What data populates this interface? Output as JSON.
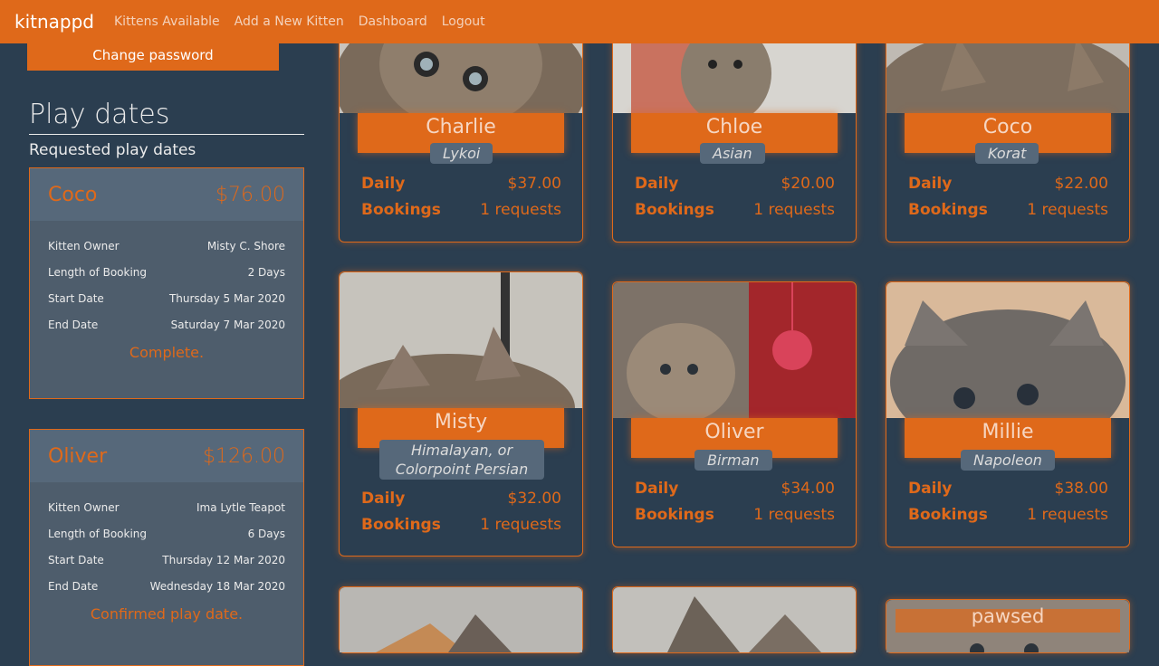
{
  "nav": {
    "brand": "kitnappd",
    "links": [
      "Kittens Available",
      "Add a New Kitten",
      "Dashboard",
      "Logout"
    ]
  },
  "sidebar": {
    "change_password": "Change password",
    "title": "Play dates",
    "subtitle": "Requested play dates",
    "labels": {
      "owner": "Kitten Owner",
      "length": "Length of Booking",
      "start": "Start Date",
      "end": "End Date"
    },
    "playdates": [
      {
        "name": "Coco",
        "price": "$76.00",
        "owner": "Misty C. Shore",
        "length": "2 Days",
        "start": "Thursday 5 Mar 2020",
        "end": "Saturday 7 Mar 2020",
        "status": "Complete."
      },
      {
        "name": "Oliver",
        "price": "$126.00",
        "owner": "Ima Lytle Teapot",
        "length": "6 Days",
        "start": "Thursday 12 Mar 2020",
        "end": "Wednesday 18 Mar 2020",
        "status": "Confirmed play date."
      }
    ]
  },
  "kitten_labels": {
    "daily": "Daily",
    "bookings": "Bookings"
  },
  "kittens": [
    {
      "name": "Charlie",
      "breed": "Lykoi",
      "daily": "$37.00",
      "bookings": "1 requests"
    },
    {
      "name": "Chloe",
      "breed": "Asian",
      "daily": "$20.00",
      "bookings": "1 requests"
    },
    {
      "name": "Coco",
      "breed": "Korat",
      "daily": "$22.00",
      "bookings": "1 requests"
    },
    {
      "name": "Misty",
      "breed": "Himalayan, or Colorpoint Persian",
      "daily": "$32.00",
      "bookings": "1 requests"
    },
    {
      "name": "Oliver",
      "breed": "Birman",
      "daily": "$34.00",
      "bookings": "1 requests"
    },
    {
      "name": "Millie",
      "breed": "Napoleon",
      "daily": "$38.00",
      "bookings": "1 requests"
    }
  ],
  "paused_label": "pawsed",
  "colors": {
    "accent": "#df691a",
    "background": "#2b3e50",
    "card": "#4e5d6c"
  }
}
